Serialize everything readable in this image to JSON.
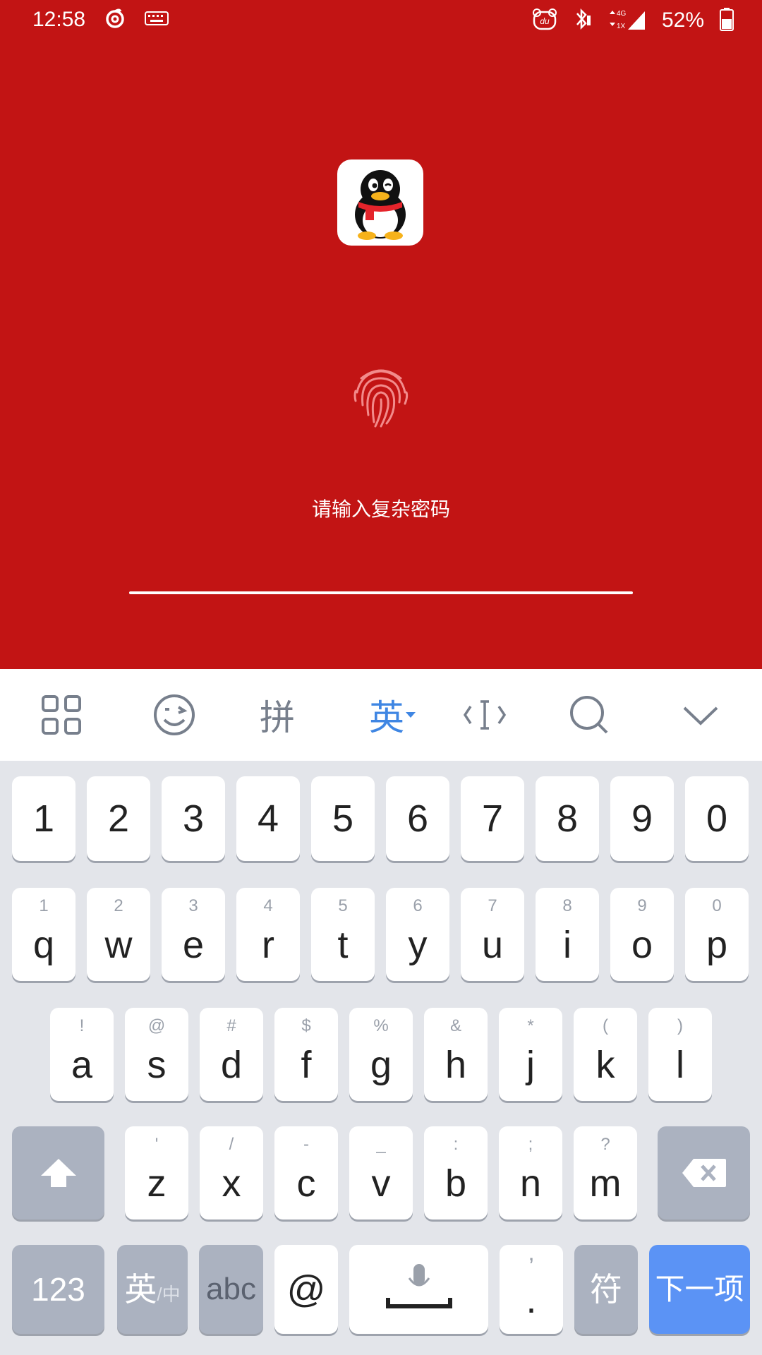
{
  "status": {
    "time": "12:58",
    "battery": "52%",
    "network": "4G"
  },
  "lock": {
    "prompt": "请输入复杂密码"
  },
  "toolbar": {
    "pinyin": "拼",
    "english": "英"
  },
  "keys": {
    "numbers": [
      "1",
      "2",
      "3",
      "4",
      "5",
      "6",
      "7",
      "8",
      "9",
      "0"
    ],
    "row1": [
      {
        "main": "q",
        "sub": "1"
      },
      {
        "main": "w",
        "sub": "2"
      },
      {
        "main": "e",
        "sub": "3"
      },
      {
        "main": "r",
        "sub": "4"
      },
      {
        "main": "t",
        "sub": "5"
      },
      {
        "main": "y",
        "sub": "6"
      },
      {
        "main": "u",
        "sub": "7"
      },
      {
        "main": "i",
        "sub": "8"
      },
      {
        "main": "o",
        "sub": "9"
      },
      {
        "main": "p",
        "sub": "0"
      }
    ],
    "row2": [
      {
        "main": "a",
        "sub": "!"
      },
      {
        "main": "s",
        "sub": "@"
      },
      {
        "main": "d",
        "sub": "#"
      },
      {
        "main": "f",
        "sub": "$"
      },
      {
        "main": "g",
        "sub": "%"
      },
      {
        "main": "h",
        "sub": "&"
      },
      {
        "main": "j",
        "sub": "*"
      },
      {
        "main": "k",
        "sub": "("
      },
      {
        "main": "l",
        "sub": ")"
      }
    ],
    "row3": [
      {
        "main": "z",
        "sub": "'"
      },
      {
        "main": "x",
        "sub": "/"
      },
      {
        "main": "c",
        "sub": "-"
      },
      {
        "main": "v",
        "sub": "_"
      },
      {
        "main": "b",
        "sub": ":"
      },
      {
        "main": "n",
        "sub": ";"
      },
      {
        "main": "m",
        "sub": "?"
      }
    ],
    "bottom": {
      "num": "123",
      "lang_main": "英",
      "lang_sub": "/中",
      "abc": "abc",
      "at": "@",
      "dot": ".",
      "dot_sub": "’",
      "symbols": "符",
      "next": "下一项"
    }
  },
  "colors": {
    "background": "#C21414",
    "keyboard": "#E3E5EA",
    "accent": "#3f86e3",
    "next_key": "#5B93F5"
  }
}
